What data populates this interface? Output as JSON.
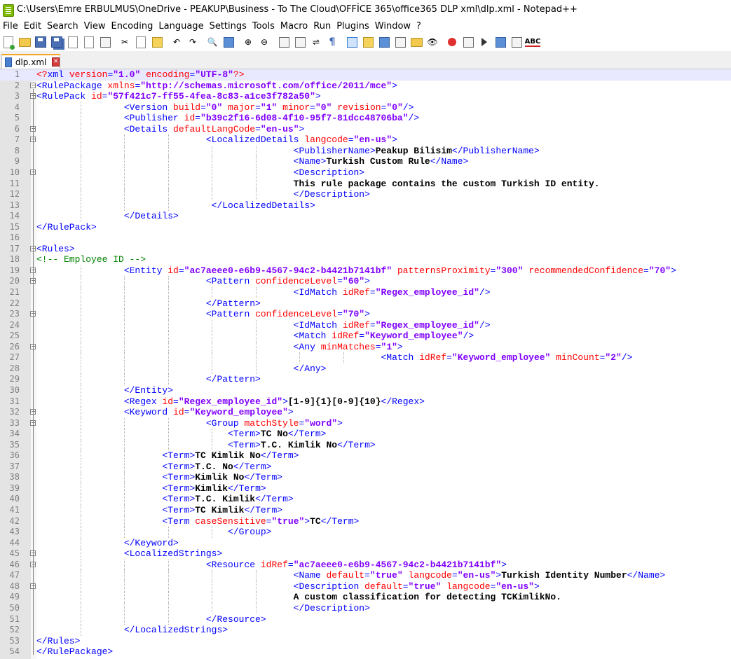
{
  "window": {
    "title": "C:\\Users\\Emre ERBULMUS\\OneDrive - PEAKUP\\Business - To The Cloud\\OFFİCE 365\\office365 DLP xml\\dlp.xml - Notepad++"
  },
  "menu": [
    "File",
    "Edit",
    "Search",
    "View",
    "Encoding",
    "Language",
    "Settings",
    "Tools",
    "Macro",
    "Run",
    "Plugins",
    "Window",
    "?"
  ],
  "toolbar": {
    "icons": [
      "new-file-icon",
      "open-file-icon",
      "save-icon",
      "save-all-icon",
      "close-icon",
      "close-all-icon",
      "print-icon",
      "cut-icon",
      "copy-icon",
      "paste-icon",
      "undo-icon",
      "redo-icon",
      "find-icon",
      "replace-icon",
      "zoom-in-icon",
      "zoom-out-icon",
      "sync-vertical-icon",
      "sync-horizontal-icon",
      "word-wrap-icon",
      "show-all-characters-icon",
      "indent-guide-icon",
      "udl-icon",
      "document-map-icon",
      "function-list-icon",
      "folder-workspace-icon",
      "monitoring-icon",
      "record-macro-icon",
      "stop-recording-icon",
      "playback-macro-icon",
      "run-macro-multiple-icon",
      "save-macro-icon",
      "spell-check-icon"
    ],
    "spell_label": "ABC"
  },
  "tabs": [
    {
      "label": "dlp.xml",
      "active": true
    }
  ],
  "editor": {
    "current_line": 1,
    "lines": [
      [
        [
          "decl",
          "<?"
        ],
        [
          "tag",
          "xml "
        ],
        [
          "attr",
          "version"
        ],
        [
          "tag",
          "="
        ],
        [
          "val",
          "\"1.0\""
        ],
        [
          "tag",
          " "
        ],
        [
          "attr",
          "encoding"
        ],
        [
          "tag",
          "="
        ],
        [
          "val",
          "\"UTF-8\""
        ],
        [
          "decl",
          "?>"
        ]
      ],
      [
        [
          "tag",
          "<RulePackage "
        ],
        [
          "attr",
          "xmlns"
        ],
        [
          "tag",
          "="
        ],
        [
          "val",
          "\"http://schemas.microsoft.com/office/2011/mce\""
        ],
        [
          "tag",
          ">"
        ]
      ],
      [
        [
          "tag",
          "<RulePack "
        ],
        [
          "attr",
          "id"
        ],
        [
          "tag",
          "="
        ],
        [
          "val",
          "\"57f421c7-ff55-4fea-8c83-a1ce3f782a50\""
        ],
        [
          "tag",
          ">"
        ]
      ],
      [
        [
          "ws",
          "                "
        ],
        [
          "tag",
          "<Version "
        ],
        [
          "attr",
          "build"
        ],
        [
          "tag",
          "="
        ],
        [
          "val",
          "\"0\""
        ],
        [
          "tag",
          " "
        ],
        [
          "attr",
          "major"
        ],
        [
          "tag",
          "="
        ],
        [
          "val",
          "\"1\""
        ],
        [
          "tag",
          " "
        ],
        [
          "attr",
          "minor"
        ],
        [
          "tag",
          "="
        ],
        [
          "val",
          "\"0\""
        ],
        [
          "tag",
          " "
        ],
        [
          "attr",
          "revision"
        ],
        [
          "tag",
          "="
        ],
        [
          "val",
          "\"0\""
        ],
        [
          "tag",
          "/>"
        ]
      ],
      [
        [
          "ws",
          "                "
        ],
        [
          "tag",
          "<Publisher "
        ],
        [
          "attr",
          "id"
        ],
        [
          "tag",
          "="
        ],
        [
          "val",
          "\"b39c2f16-6d08-4f10-95f7-81dcc48706ba\""
        ],
        [
          "tag",
          "/>"
        ]
      ],
      [
        [
          "ws",
          "                "
        ],
        [
          "tag",
          "<Details "
        ],
        [
          "attr",
          "defaultLangCode"
        ],
        [
          "tag",
          "="
        ],
        [
          "val",
          "\"en-us\""
        ],
        [
          "tag",
          ">"
        ]
      ],
      [
        [
          "ws",
          "                               "
        ],
        [
          "tag",
          "<LocalizedDetails "
        ],
        [
          "attr",
          "langcode"
        ],
        [
          "tag",
          "="
        ],
        [
          "val",
          "\"en-us\""
        ],
        [
          "tag",
          ">"
        ]
      ],
      [
        [
          "ws",
          "                                               "
        ],
        [
          "tag",
          "<PublisherName>"
        ],
        [
          "text",
          "Peakup Bilisim"
        ],
        [
          "tag",
          "</PublisherName>"
        ]
      ],
      [
        [
          "ws",
          "                                               "
        ],
        [
          "tag",
          "<Name>"
        ],
        [
          "text",
          "Turkish Custom Rule"
        ],
        [
          "tag",
          "</Name>"
        ]
      ],
      [
        [
          "ws",
          "                                               "
        ],
        [
          "tag",
          "<Description>"
        ]
      ],
      [
        [
          "ws",
          "                                               "
        ],
        [
          "text",
          "This rule package contains the custom Turkish ID entity."
        ]
      ],
      [
        [
          "ws",
          "                                               "
        ],
        [
          "tag",
          "</Description>"
        ]
      ],
      [
        [
          "ws",
          "                                "
        ],
        [
          "tag",
          "</LocalizedDetails>"
        ]
      ],
      [
        [
          "ws",
          "                "
        ],
        [
          "tag",
          "</Details>"
        ]
      ],
      [
        [
          "tag",
          "</RulePack>"
        ]
      ],
      [],
      [
        [
          "tag",
          "<Rules>"
        ]
      ],
      [
        [
          "com",
          "<!-- Employee ID -->"
        ]
      ],
      [
        [
          "ws",
          "                "
        ],
        [
          "tag",
          "<Entity "
        ],
        [
          "attr",
          "id"
        ],
        [
          "tag",
          "="
        ],
        [
          "val",
          "\"ac7aeee0-e6b9-4567-94c2-b4421b7141bf\""
        ],
        [
          "tag",
          " "
        ],
        [
          "attr",
          "patternsProximity"
        ],
        [
          "tag",
          "="
        ],
        [
          "val",
          "\"300\""
        ],
        [
          "tag",
          " "
        ],
        [
          "attr",
          "recommendedConfidence"
        ],
        [
          "tag",
          "="
        ],
        [
          "val",
          "\"70\""
        ],
        [
          "tag",
          ">"
        ]
      ],
      [
        [
          "ws",
          "                               "
        ],
        [
          "tag",
          "<Pattern "
        ],
        [
          "attr",
          "confidenceLevel"
        ],
        [
          "tag",
          "="
        ],
        [
          "val",
          "\"60\""
        ],
        [
          "tag",
          ">"
        ]
      ],
      [
        [
          "ws",
          "                                               "
        ],
        [
          "tag",
          "<IdMatch "
        ],
        [
          "attr",
          "idRef"
        ],
        [
          "tag",
          "="
        ],
        [
          "val",
          "\"Regex_employee_id\""
        ],
        [
          "tag",
          "/>"
        ]
      ],
      [
        [
          "ws",
          "                               "
        ],
        [
          "tag",
          "</Pattern>"
        ]
      ],
      [
        [
          "ws",
          "                               "
        ],
        [
          "tag",
          "<Pattern "
        ],
        [
          "attr",
          "confidenceLevel"
        ],
        [
          "tag",
          "="
        ],
        [
          "val",
          "\"70\""
        ],
        [
          "tag",
          ">"
        ]
      ],
      [
        [
          "ws",
          "                                               "
        ],
        [
          "tag",
          "<IdMatch "
        ],
        [
          "attr",
          "idRef"
        ],
        [
          "tag",
          "="
        ],
        [
          "val",
          "\"Regex_employee_id\""
        ],
        [
          "tag",
          "/>"
        ]
      ],
      [
        [
          "ws",
          "                                               "
        ],
        [
          "tag",
          "<Match "
        ],
        [
          "attr",
          "idRef"
        ],
        [
          "tag",
          "="
        ],
        [
          "val",
          "\"Keyword_employee\""
        ],
        [
          "tag",
          "/>"
        ]
      ],
      [
        [
          "ws",
          "                                               "
        ],
        [
          "tag",
          "<Any "
        ],
        [
          "attr",
          "minMatches"
        ],
        [
          "tag",
          "="
        ],
        [
          "val",
          "\"1\""
        ],
        [
          "tag",
          ">"
        ]
      ],
      [
        [
          "ws",
          "                                                               "
        ],
        [
          "tag",
          "<Match "
        ],
        [
          "attr",
          "idRef"
        ],
        [
          "tag",
          "="
        ],
        [
          "val",
          "\"Keyword_employee\""
        ],
        [
          "tag",
          " "
        ],
        [
          "attr",
          "minCount"
        ],
        [
          "tag",
          "="
        ],
        [
          "val",
          "\"2\""
        ],
        [
          "tag",
          "/>"
        ]
      ],
      [
        [
          "ws",
          "                                               "
        ],
        [
          "tag",
          "</Any>"
        ]
      ],
      [
        [
          "ws",
          "                               "
        ],
        [
          "tag",
          "</Pattern>"
        ]
      ],
      [
        [
          "ws",
          "                "
        ],
        [
          "tag",
          "</Entity>"
        ]
      ],
      [
        [
          "ws",
          "                "
        ],
        [
          "tag",
          "<Regex "
        ],
        [
          "attr",
          "id"
        ],
        [
          "tag",
          "="
        ],
        [
          "val",
          "\"Regex_employee_id\""
        ],
        [
          "tag",
          ">"
        ],
        [
          "text",
          "[1-9]{1}[0-9]{10}"
        ],
        [
          "tag",
          "</Regex>"
        ]
      ],
      [
        [
          "ws",
          "                "
        ],
        [
          "tag",
          "<Keyword "
        ],
        [
          "attr",
          "id"
        ],
        [
          "tag",
          "="
        ],
        [
          "val",
          "\"Keyword_employee\""
        ],
        [
          "tag",
          ">"
        ]
      ],
      [
        [
          "ws",
          "                               "
        ],
        [
          "tag",
          "<Group "
        ],
        [
          "attr",
          "matchStyle"
        ],
        [
          "tag",
          "="
        ],
        [
          "val",
          "\"word\""
        ],
        [
          "tag",
          ">"
        ]
      ],
      [
        [
          "ws",
          "                                   "
        ],
        [
          "tag",
          "<Term>"
        ],
        [
          "text",
          "TC No"
        ],
        [
          "tag",
          "</Term>"
        ]
      ],
      [
        [
          "ws",
          "                                   "
        ],
        [
          "tag",
          "<Term>"
        ],
        [
          "text",
          "T.C. Kimlik No"
        ],
        [
          "tag",
          "</Term>"
        ]
      ],
      [
        [
          "ws",
          "                       "
        ],
        [
          "tag",
          "<Term>"
        ],
        [
          "text",
          "TC Kimlik No"
        ],
        [
          "tag",
          "</Term>"
        ]
      ],
      [
        [
          "ws",
          "                       "
        ],
        [
          "tag",
          "<Term>"
        ],
        [
          "text",
          "T.C. No"
        ],
        [
          "tag",
          "</Term>"
        ]
      ],
      [
        [
          "ws",
          "                       "
        ],
        [
          "tag",
          "<Term>"
        ],
        [
          "text",
          "Kimlik No"
        ],
        [
          "tag",
          "</Term>"
        ]
      ],
      [
        [
          "ws",
          "                       "
        ],
        [
          "tag",
          "<Term>"
        ],
        [
          "text",
          "Kimlik"
        ],
        [
          "tag",
          "</Term>"
        ]
      ],
      [
        [
          "ws",
          "                       "
        ],
        [
          "tag",
          "<Term>"
        ],
        [
          "text",
          "T.C. Kimlik"
        ],
        [
          "tag",
          "</Term>"
        ]
      ],
      [
        [
          "ws",
          "                       "
        ],
        [
          "tag",
          "<Term>"
        ],
        [
          "text",
          "TC Kimlik"
        ],
        [
          "tag",
          "</Term>"
        ]
      ],
      [
        [
          "ws",
          "                       "
        ],
        [
          "tag",
          "<Term "
        ],
        [
          "attr",
          "caseSensitive"
        ],
        [
          "tag",
          "="
        ],
        [
          "val",
          "\"true\""
        ],
        [
          "tag",
          ">"
        ],
        [
          "text",
          "TC"
        ],
        [
          "tag",
          "</Term>"
        ]
      ],
      [
        [
          "ws",
          "                                   "
        ],
        [
          "tag",
          "</Group>"
        ]
      ],
      [
        [
          "ws",
          "                "
        ],
        [
          "tag",
          "</Keyword>"
        ]
      ],
      [
        [
          "ws",
          "                "
        ],
        [
          "tag",
          "<LocalizedStrings>"
        ]
      ],
      [
        [
          "ws",
          "                               "
        ],
        [
          "tag",
          "<Resource "
        ],
        [
          "attr",
          "idRef"
        ],
        [
          "tag",
          "="
        ],
        [
          "val",
          "\"ac7aeee0-e6b9-4567-94c2-b4421b7141bf\""
        ],
        [
          "tag",
          ">"
        ]
      ],
      [
        [
          "ws",
          "                                               "
        ],
        [
          "tag",
          "<Name "
        ],
        [
          "attr",
          "default"
        ],
        [
          "tag",
          "="
        ],
        [
          "val",
          "\"true\""
        ],
        [
          "tag",
          " "
        ],
        [
          "attr",
          "langcode"
        ],
        [
          "tag",
          "="
        ],
        [
          "val",
          "\"en-us\""
        ],
        [
          "tag",
          ">"
        ],
        [
          "text",
          "Turkish Identity Number"
        ],
        [
          "tag",
          "</Name>"
        ]
      ],
      [
        [
          "ws",
          "                                               "
        ],
        [
          "tag",
          "<Description "
        ],
        [
          "attr",
          "default"
        ],
        [
          "tag",
          "="
        ],
        [
          "val",
          "\"true\""
        ],
        [
          "tag",
          " "
        ],
        [
          "attr",
          "langcode"
        ],
        [
          "tag",
          "="
        ],
        [
          "val",
          "\"en-us\""
        ],
        [
          "tag",
          ">"
        ]
      ],
      [
        [
          "ws",
          "                                               "
        ],
        [
          "text",
          "A custom classification for detecting TCKimlikNo."
        ]
      ],
      [
        [
          "ws",
          "                                               "
        ],
        [
          "tag",
          "</Description>"
        ]
      ],
      [
        [
          "ws",
          "                               "
        ],
        [
          "tag",
          "</Resource>"
        ]
      ],
      [
        [
          "ws",
          "                "
        ],
        [
          "tag",
          "</LocalizedStrings>"
        ]
      ],
      [
        [
          "tag",
          "</Rules>"
        ]
      ],
      [
        [
          "tag",
          "</RulePackage>"
        ]
      ]
    ]
  }
}
